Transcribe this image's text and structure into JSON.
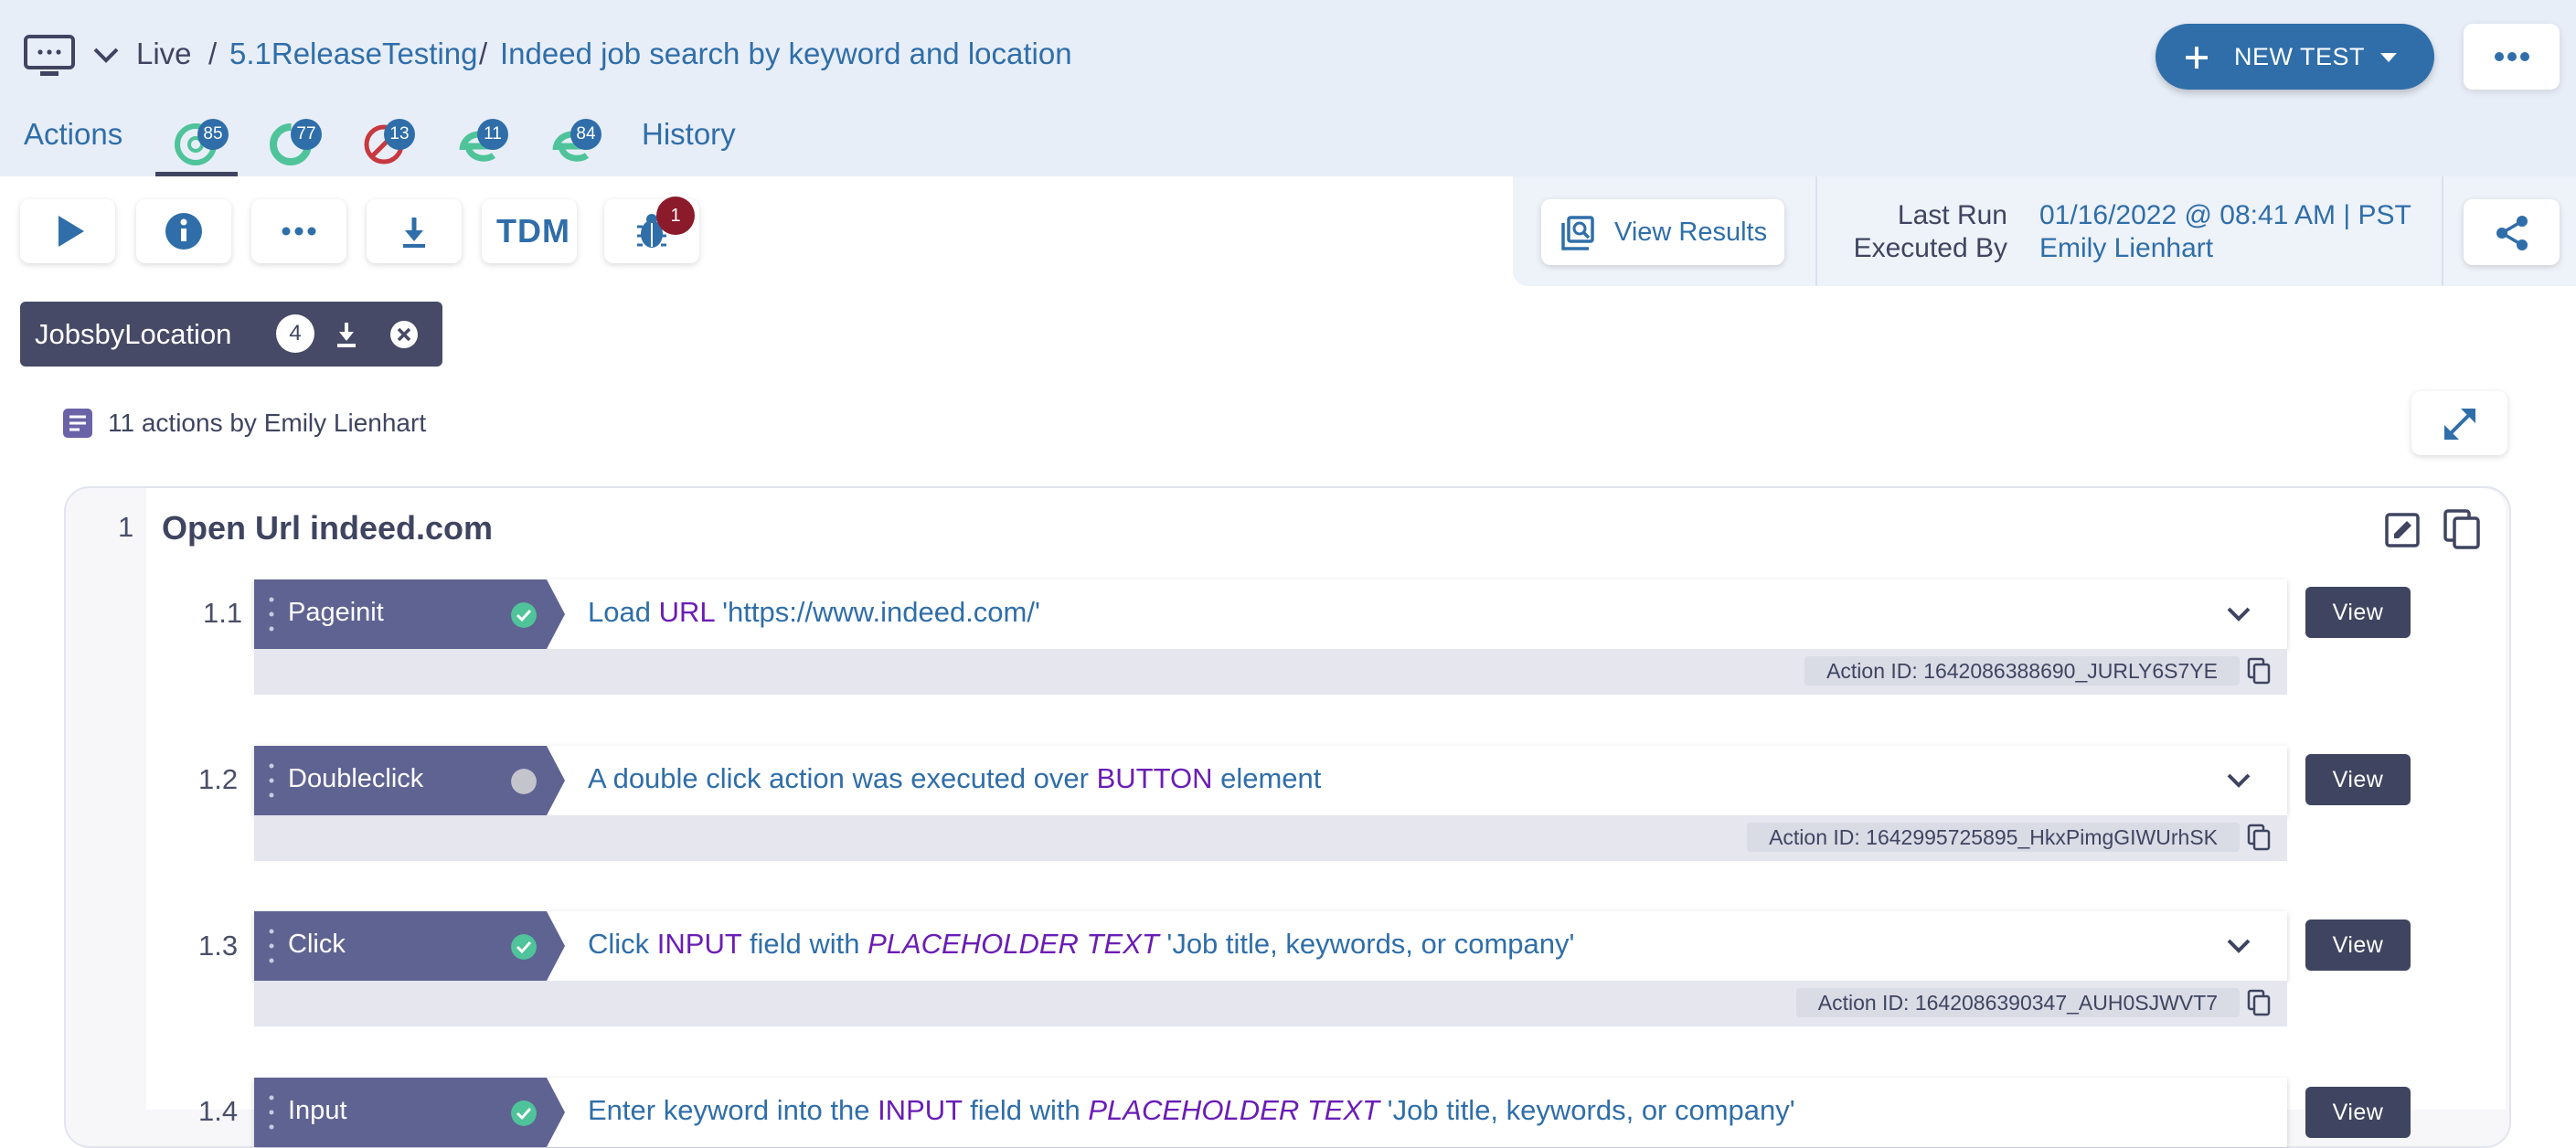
{
  "header": {
    "env_label": "Live",
    "separator": "/",
    "project": "5.1ReleaseTesting",
    "test_name": "Indeed job search by keyword and location",
    "new_test_label": "NEW TEST"
  },
  "tabs": {
    "actions_label": "Actions",
    "history_label": "History",
    "browser_badges": [
      {
        "browser": "chrome",
        "count": "85"
      },
      {
        "browser": "firefox",
        "count": "77"
      },
      {
        "browser": "safari",
        "count": "13"
      },
      {
        "browser": "edge",
        "count": "11"
      },
      {
        "browser": "edge-chromium",
        "count": "84"
      }
    ]
  },
  "toolbar": {
    "tdm_label": "TDM",
    "bug_count": "1",
    "view_results_label": "View Results",
    "last_run_label": "Last Run",
    "last_run_value": "01/16/2022 @ 08:41 AM | PST",
    "executed_by_label": "Executed By",
    "executed_by_value": "Emily Lienhart"
  },
  "dataset_chip": {
    "name": "JobsbyLocation",
    "count": "4"
  },
  "summary": {
    "text": "11 actions by Emily Lienhart"
  },
  "group": {
    "number": "1",
    "title": "Open Url indeed.com"
  },
  "steps": [
    {
      "num": "1.1",
      "type": "Pageinit",
      "status": "passed",
      "desc_plain1": "Load ",
      "desc_kw1": "URL",
      "desc_plain2": " 'https://www.indeed.com/'",
      "action_id": "Action ID: 1642086388690_JURLY6S7YE",
      "view_label": "View"
    },
    {
      "num": "1.2",
      "type": "Doubleclick",
      "status": "not-run",
      "desc_plain1": "A double click action was executed over ",
      "desc_kw1": "BUTTON",
      "desc_plain2": " element",
      "action_id": "Action ID: 1642995725895_HkxPimgGIWUrhSK",
      "view_label": "View"
    },
    {
      "num": "1.3",
      "type": "Click",
      "status": "passed",
      "desc_plain1": "Click ",
      "desc_kw1": "INPUT",
      "desc_plain2": " field with ",
      "desc_kw2": "PLACEHOLDER TEXT",
      "desc_plain3": " 'Job title, keywords, or company'",
      "action_id": "Action ID: 1642086390347_AUH0SJWVT7",
      "view_label": "View"
    },
    {
      "num": "1.4",
      "type": "Input",
      "status": "passed",
      "desc_plain1": "Enter keyword into the ",
      "desc_kw1": "INPUT",
      "desc_plain2": " field with ",
      "desc_kw2": "PLACEHOLDER TEXT",
      "desc_plain3": " 'Job title, keywords, or company'",
      "view_label": "View"
    }
  ],
  "colors": {
    "accent": "#2f6ea9",
    "header_bg": "#e8eef8",
    "step_tag": "#5f6392",
    "dark": "#3f4560",
    "success": "#4fc39a",
    "keyword": "#6a1db5",
    "bug_badge": "#8b1a2b"
  }
}
